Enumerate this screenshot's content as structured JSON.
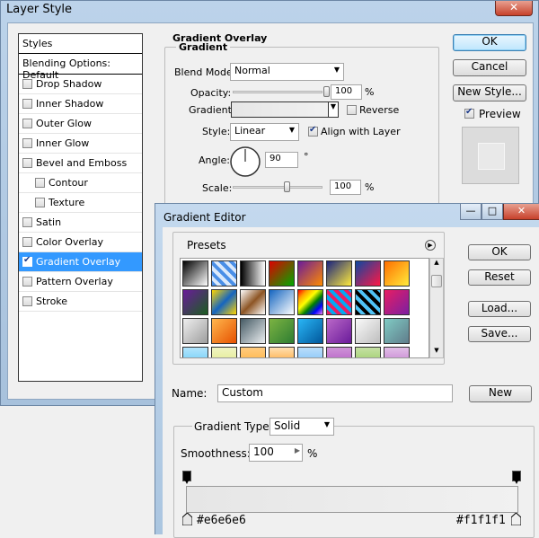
{
  "layer_style": {
    "title": "Layer Style",
    "close": "✕",
    "styles_header": "Styles",
    "blending_options": "Blending Options: Default",
    "items": [
      {
        "label": "Drop Shadow",
        "checked": false,
        "sub": false
      },
      {
        "label": "Inner Shadow",
        "checked": false,
        "sub": false
      },
      {
        "label": "Outer Glow",
        "checked": false,
        "sub": false
      },
      {
        "label": "Inner Glow",
        "checked": false,
        "sub": false
      },
      {
        "label": "Bevel and Emboss",
        "checked": false,
        "sub": false
      },
      {
        "label": "Contour",
        "checked": false,
        "sub": true
      },
      {
        "label": "Texture",
        "checked": false,
        "sub": true
      },
      {
        "label": "Satin",
        "checked": false,
        "sub": false
      },
      {
        "label": "Color Overlay",
        "checked": false,
        "sub": false
      },
      {
        "label": "Gradient Overlay",
        "checked": true,
        "sub": false,
        "active": true
      },
      {
        "label": "Pattern Overlay",
        "checked": false,
        "sub": false
      },
      {
        "label": "Stroke",
        "checked": false,
        "sub": false
      }
    ],
    "section_title": "Gradient Overlay",
    "group_title": "Gradient",
    "blend_mode_label": "Blend Mode:",
    "blend_mode_value": "Normal",
    "opacity_label": "Opacity:",
    "opacity_value": "100",
    "opacity_unit": "%",
    "opacity_level": 1.0,
    "gradient_label": "Gradient:",
    "reverse_label": "Reverse",
    "style_label": "Style:",
    "style_value": "Linear",
    "align_label": "Align with Layer",
    "angle_label": "Angle:",
    "angle_value": "90",
    "angle_unit": "°",
    "scale_label": "Scale:",
    "scale_value": "100",
    "scale_unit": "%",
    "ok": "OK",
    "cancel": "Cancel",
    "new_style": "New Style...",
    "preview_label": "Preview"
  },
  "gradient_editor": {
    "title": "Gradient Editor",
    "minimize": "—",
    "maximize": "□",
    "close": "✕",
    "presets_label": "Presets",
    "ok": "OK",
    "reset": "Reset",
    "load": "Load...",
    "save": "Save...",
    "name_label": "Name:",
    "name_value": "Custom",
    "new_button": "New",
    "gradient_type_label": "Gradient Type:",
    "gradient_type_value": "Solid",
    "smoothness_label": "Smoothness:",
    "smoothness_value": "100",
    "smoothness_unit": "%",
    "left_stop_color": "#e6e6e6",
    "right_stop_color": "#f1f1f1",
    "presets": [
      "linear-gradient(135deg,#000,#fff)",
      "repeating-linear-gradient(45deg,#4a8fe7 0 4px,#dbe9fb 4px 8px)",
      "linear-gradient(to right,#000,#fff)",
      "linear-gradient(135deg,#d00,#0a0)",
      "linear-gradient(135deg,#6a1b9a,#ff8c00)",
      "linear-gradient(135deg,#1a237e,#ffeb3b)",
      "linear-gradient(135deg,#0d47a1,#ff1744)",
      "linear-gradient(135deg,#ff6f00,#ffeb3b)",
      "linear-gradient(135deg,#6a1b9a,#1b5e20)",
      "linear-gradient(135deg,#ffd600,#1565c0,#ffd600)",
      "linear-gradient(135deg,#fff,#8d5524,#fff)",
      "linear-gradient(135deg,#1565c0,#fff)",
      "linear-gradient(135deg,red,orange,yellow,green,blue,violet)",
      "repeating-linear-gradient(45deg,#e91e63 0 4px,#03a9f4 4px 8px)",
      "repeating-linear-gradient(45deg,#000 0 4px,#4fc3f7 4px 8px)",
      "linear-gradient(135deg,#e91e63,#7b1fa2)",
      "linear-gradient(135deg,#eee,#9e9e9e)",
      "linear-gradient(135deg,#ffb74d,#e65100)",
      "linear-gradient(135deg,#455a64,#eceff1)",
      "linear-gradient(135deg,#7cb342,#2e7d32)",
      "linear-gradient(135deg,#29b6f6,#01579b)",
      "linear-gradient(135deg,#ba68c8,#6a1b9a)",
      "linear-gradient(135deg,#fafafa,#bdbdbd)",
      "linear-gradient(135deg,#80cbc4,#607d8b)",
      "linear-gradient(#b3e5fc,#4fc3f7)",
      "linear-gradient(#f0f4c3,#dce775)",
      "linear-gradient(#ffcc80,#ffa726)",
      "linear-gradient(#ffe0b2,#fb8c00)",
      "linear-gradient(#bbdefb,#64b5f6)",
      "linear-gradient(#ce93d8,#ab47bc)",
      "linear-gradient(#c5e1a5,#8bc34a)",
      "linear-gradient(#e1bee7,#ba68c8)"
    ]
  }
}
